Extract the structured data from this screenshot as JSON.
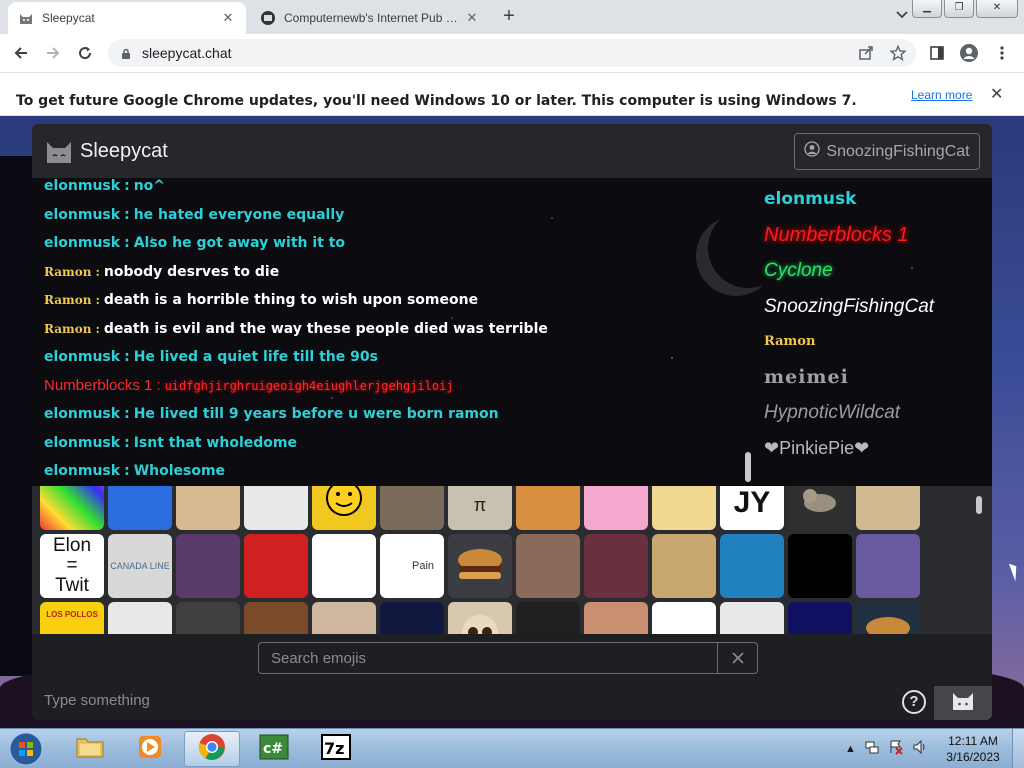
{
  "browser": {
    "tabs": [
      {
        "title": "Sleepycat",
        "active": true
      },
      {
        "title": "Computernewb's Internet Pub Hub",
        "active": false
      }
    ],
    "url": "sleepycat.chat",
    "infobar": {
      "message": "To get future Google Chrome updates, you'll need Windows 10 or later. This computer is using Windows 7.",
      "link": "Learn more"
    }
  },
  "app": {
    "name": "Sleepycat",
    "current_user": "SnoozingFishingCat",
    "messages": [
      {
        "user": "elonmusk",
        "text": "no^",
        "style": "elon"
      },
      {
        "user": "elonmusk",
        "text": "he hated everyone equally",
        "style": "elon"
      },
      {
        "user": "elonmusk",
        "text": "Also he got away with it to",
        "style": "elon"
      },
      {
        "user": "Ramon",
        "text": "nobody desrves to die",
        "style": "ramon"
      },
      {
        "user": "Ramon",
        "text": "death is a horrible thing to wish upon someone",
        "style": "ramon"
      },
      {
        "user": "Ramon",
        "text": "death is evil and the way these people died was terrible",
        "style": "ramon"
      },
      {
        "user": "elonmusk",
        "text": "He lived a quiet life till the 90s",
        "style": "elon"
      },
      {
        "user": "Numberblocks 1",
        "text": "uidfghjirghruigeoigh4eiughlerjgehgjiloij",
        "style": "nb"
      },
      {
        "user": "elonmusk",
        "text": "He lived till 9 years before u were born ramon",
        "style": "elon"
      },
      {
        "user": "elonmusk",
        "text": "Isnt that wholedome",
        "style": "elon"
      },
      {
        "user": "elonmusk",
        "text": "Wholesome",
        "style": "elon"
      }
    ],
    "online_users": [
      {
        "name": "elonmusk",
        "style": "elon"
      },
      {
        "name": "Numberblocks 1",
        "style": "nb"
      },
      {
        "name": "Cyclone",
        "style": "cyc"
      },
      {
        "name": "SnoozingFishingCat",
        "style": "snz"
      },
      {
        "name": "Ramon",
        "style": "ramon"
      },
      {
        "name": "meimei",
        "style": "mei"
      },
      {
        "name": "HypnoticWildcat",
        "style": "hyp"
      },
      {
        "name": "❤PinkiePie❤",
        "style": "pinkie"
      }
    ],
    "emoji_labels": {
      "elon_twit": "Elon = Twit",
      "pain": "Pain",
      "pi": "π",
      "jy": "JY",
      "canada": "CANADA LINE",
      "los_pollos": "LOS POLLOS"
    },
    "search_placeholder": "Search emojis",
    "compose_placeholder": "Type something",
    "help_label": "?"
  },
  "taskbar": {
    "time": "12:11 AM",
    "date": "3/16/2023"
  }
}
